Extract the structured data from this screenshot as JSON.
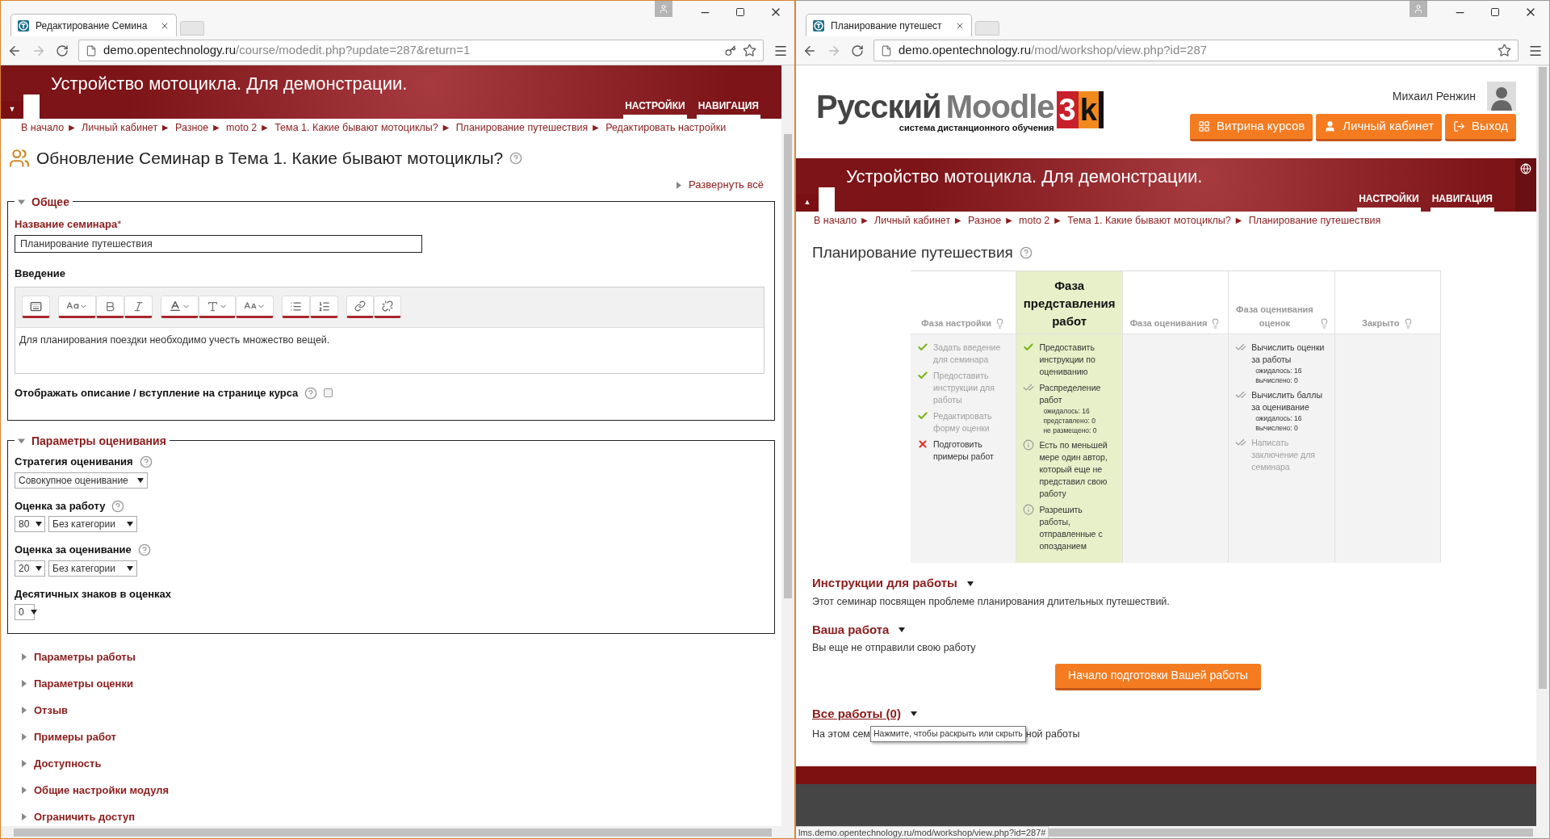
{
  "left_window": {
    "tab_title": "Редактирование Семина",
    "url": {
      "host": "demo.opentechnology.ru",
      "path": "/course/modedit.php?update=287&return=1"
    },
    "banner": {
      "title": "Устройство мотоцикла. Для демонстрации.",
      "toggle": "▼",
      "menu": [
        "НАСТРОЙКИ",
        "НАВИГАЦИЯ"
      ]
    },
    "breadcrumbs": [
      "В начало ►",
      "Личный кабинет ►",
      "Разное ►",
      "moto 2 ►",
      "Тема 1. Какие бывают мотоциклы? ►",
      "Планирование путешествия ►",
      "Редактировать настройки"
    ],
    "page_title": "Обновление Семинар в Тема 1. Какие бывают мотоциклы?",
    "expand_all": "Развернуть всё",
    "general": {
      "legend": "Общее",
      "expanded": true,
      "name_label": "Название семинара",
      "required_mark": "*",
      "name_value": "Планирование путешествия",
      "intro_label": "Введение",
      "intro_text": "Для планирования поездки необходимо учесть множество вещей.",
      "show_desc_label": "Отображать описание / вступление на странице курса",
      "show_desc_checked": false
    },
    "grading": {
      "legend": "Параметры оценивания",
      "expanded": true,
      "strategy_label": "Стратегия оценивания",
      "strategy_value": "Совокупное оценивание",
      "submission_grade": {
        "label": "Оценка за работу",
        "value": "80",
        "category": "Без категории"
      },
      "assessment_grade": {
        "label": "Оценка за оценивание",
        "value": "20",
        "category": "Без категории"
      },
      "decimals": {
        "label": "Десятичных знаков в оценках",
        "value": "0"
      }
    },
    "collapsed_sections": [
      {
        "title": "Параметры работы",
        "expanded": false
      },
      {
        "title": "Параметры оценки",
        "expanded": false
      },
      {
        "title": "Отзыв",
        "expanded": false
      },
      {
        "title": "Примеры работ",
        "expanded": false
      },
      {
        "title": "Доступность",
        "expanded": false
      },
      {
        "title": "Общие настройки модуля",
        "expanded": false
      },
      {
        "title": "Ограничить доступ",
        "expanded": false
      }
    ]
  },
  "right_window": {
    "tab_title": "Планирование путешест",
    "url": {
      "host": "demo.opentechnology.ru",
      "path": "/mod/workshop/view.php?id=287"
    },
    "logo": {
      "word1": "Русский",
      "word2": "Moodle",
      "tagline": "система дистанционного обучения",
      "mark_digit": "3",
      "mark_letter": "k"
    },
    "user_name": "Михаил Ренжин",
    "nav_buttons": [
      {
        "label": "Витрина курсов",
        "kind": "grid"
      },
      {
        "label": "Личный кабинет",
        "kind": "user"
      },
      {
        "label": "Выход",
        "kind": "exit"
      }
    ],
    "banner": {
      "title": "Устройство мотоцикла. Для демонстрации.",
      "toggle": "▲",
      "menu": [
        "НАСТРОЙКИ",
        "НАВИГАЦИЯ"
      ]
    },
    "breadcrumbs": [
      "В начало ►",
      "Личный кабинет ►",
      "Разное ►",
      "moto 2 ►",
      "Тема 1. Какие бывают мотоциклы? ►",
      "Планирование путешествия"
    ],
    "page_title": "Планирование путешествия",
    "phases": [
      {
        "title": "Фаза настройки",
        "current": false,
        "tasks": [
          {
            "kind": "done",
            "dimmed": true,
            "text": "Задать введение для семинара"
          },
          {
            "kind": "done",
            "dimmed": true,
            "text": "Предоставить инструкции для работы"
          },
          {
            "kind": "done",
            "dimmed": true,
            "text": "Редактировать форму оценки"
          },
          {
            "kind": "fail",
            "dimmed": false,
            "text": "Подготовить примеры работ"
          }
        ]
      },
      {
        "title": "Фаза представления работ",
        "current": true,
        "tasks": [
          {
            "kind": "done",
            "dimmed": false,
            "text": "Предоставить инструкции по оцениванию"
          },
          {
            "kind": "todo",
            "dimmed": false,
            "text": "Распределение работ",
            "details": [
              "ожидалось: 16",
              "представлено: 0",
              "не размещено: 0"
            ]
          },
          {
            "kind": "info",
            "dimmed": false,
            "text": "Есть по меньшей мере один автор, который еще не представил свою работу"
          },
          {
            "kind": "info",
            "dimmed": false,
            "text": "Разрешить работы, отправленные с опозданием"
          }
        ]
      },
      {
        "title": "Фаза оценивания",
        "current": false
      },
      {
        "title": "Фаза оценивания оценок",
        "current": false,
        "tasks": [
          {
            "kind": "todo",
            "dimmed": false,
            "text": "Вычислить оценки за работы",
            "details": [
              "ожидалось: 16",
              "вычислено: 0"
            ]
          },
          {
            "kind": "todo",
            "dimmed": false,
            "text": "Вычислить баллы за оценивание",
            "details": [
              "ожидалось: 16",
              "вычислено: 0"
            ]
          },
          {
            "kind": "todo",
            "dimmed": true,
            "text": "Написать заключение для семинара"
          }
        ]
      },
      {
        "title": "Закрыто",
        "current": false
      }
    ],
    "instructions": {
      "title": "Инструкции для работы",
      "text": "Этот семинар посвящен проблеме планирования длительных путешествий."
    },
    "your_work": {
      "title": "Ваша работа",
      "text": "Вы еще не отправили свою работу",
      "button": "Начало подготовки Вашей работы"
    },
    "all_works": {
      "title": "Все работы (0)",
      "text_before": "На этом сем",
      "text_after": "ной работы",
      "tooltip": "Нажмите, чтобы раскрыть или скрыть"
    },
    "status_url": "lms.demo.opentechnology.ru/mod/workshop/view.php?id=287#"
  }
}
